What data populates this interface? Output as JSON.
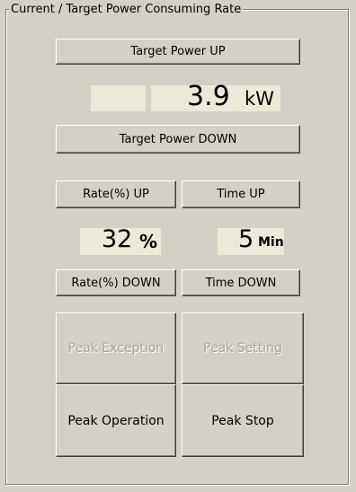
{
  "group": {
    "title": "Current / Target Power Consuming Rate"
  },
  "target_power": {
    "up_label": "Target Power UP",
    "down_label": "Target Power DOWN",
    "value": "3.9",
    "unit": "kW"
  },
  "rate": {
    "up_label": "Rate(%) UP",
    "down_label": "Rate(%) DOWN",
    "value": "32",
    "unit": "%"
  },
  "time": {
    "up_label": "Time UP",
    "down_label": "Time DOWN",
    "value": "5",
    "unit": "Min"
  },
  "peak": {
    "exception_label": "Peak Exception",
    "setting_label": "Peak Setting",
    "operation_label": "Peak Operation",
    "stop_label": "Peak Stop"
  }
}
